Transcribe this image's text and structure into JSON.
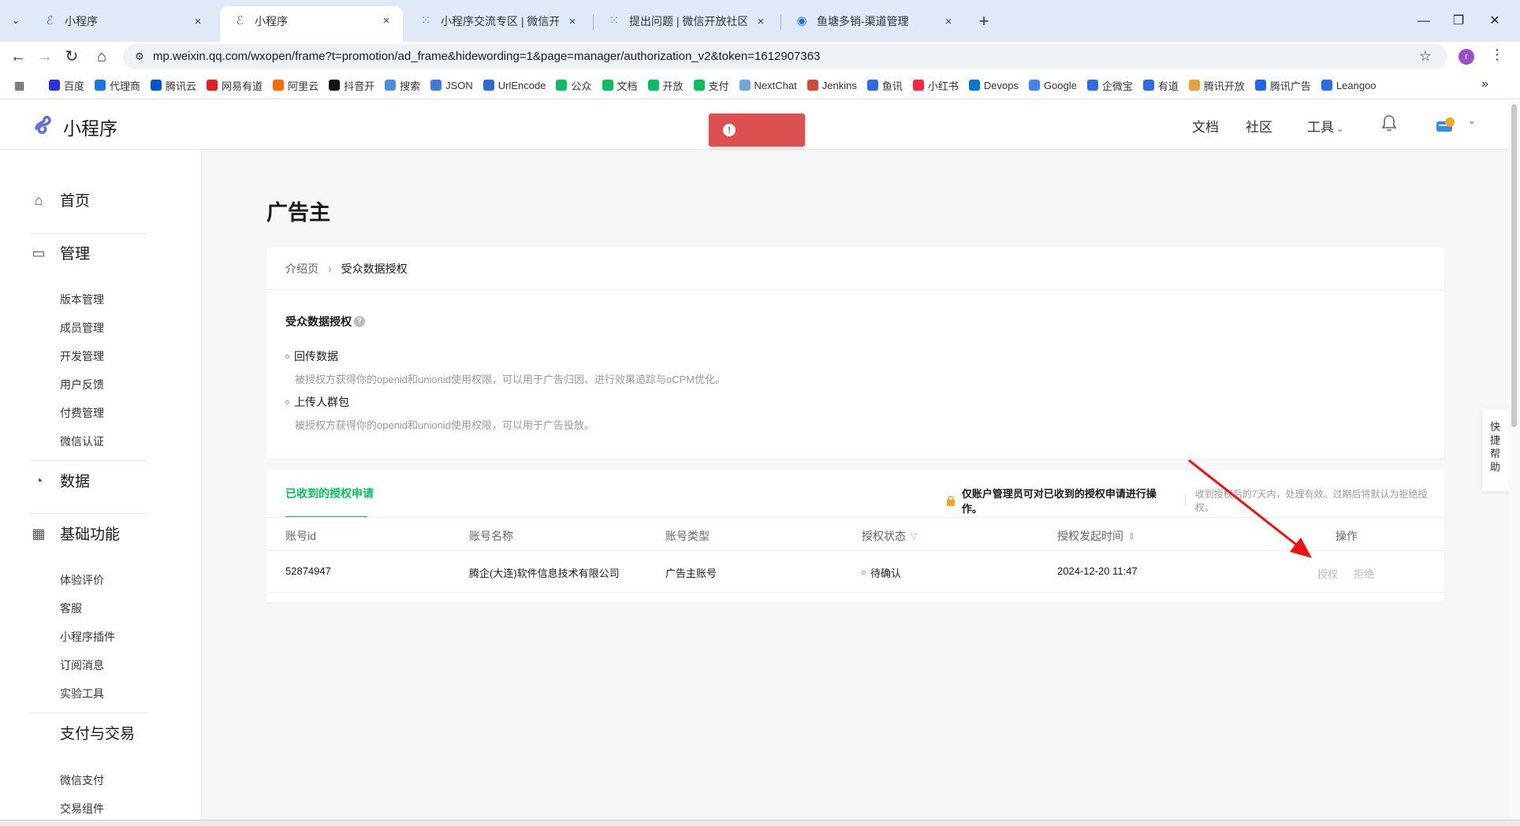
{
  "browser": {
    "tabs": [
      {
        "title": "小程序",
        "icon": "miniprogram-icon",
        "active": false
      },
      {
        "title": "小程序",
        "icon": "miniprogram-icon",
        "active": true
      },
      {
        "title": "小程序交流专区 | 微信开放社区",
        "icon": "community-grid-icon",
        "active": false
      },
      {
        "title": "提出问题 | 微信开放社区",
        "icon": "community-grid-icon",
        "active": false
      },
      {
        "title": "鱼塘多销-渠道管理",
        "icon": "globe-icon",
        "active": false
      }
    ],
    "url": "mp.weixin.qq.com/wxopen/frame?t=promotion/ad_frame&hidewording=1&page=manager/authorization_v2&token=1612907363",
    "profile_initial": "r",
    "bookmarks": [
      {
        "label": "百度",
        "color": "#2932e1"
      },
      {
        "label": "代理商",
        "color": "#1a73e8"
      },
      {
        "label": "腾讯云",
        "color": "#0052d9"
      },
      {
        "label": "网易有道",
        "color": "#e02020"
      },
      {
        "label": "阿里云",
        "color": "#ff6a00"
      },
      {
        "label": "抖音开",
        "color": "#111111"
      },
      {
        "label": "搜索",
        "color": "#4a90e2"
      },
      {
        "label": "JSON",
        "color": "#3b7ddd"
      },
      {
        "label": "UrlEncode",
        "color": "#2a6bd1"
      },
      {
        "label": "公众",
        "color": "#07c160"
      },
      {
        "label": "文档",
        "color": "#07c160"
      },
      {
        "label": "开放",
        "color": "#07c160"
      },
      {
        "label": "支付",
        "color": "#07c160"
      },
      {
        "label": "NextChat",
        "color": "#6fa8dc"
      },
      {
        "label": "Jenkins",
        "color": "#d24939"
      },
      {
        "label": "鱼讯",
        "color": "#2b6de8"
      },
      {
        "label": "小红书",
        "color": "#ff2442"
      },
      {
        "label": "Devops",
        "color": "#0078d4"
      },
      {
        "label": "Google",
        "color": "#4285f4"
      },
      {
        "label": "企微宝",
        "color": "#2b6de8"
      },
      {
        "label": "有道",
        "color": "#2b6de8"
      },
      {
        "label": "腾讯开放",
        "color": "#e9a23b"
      },
      {
        "label": "腾讯广告",
        "color": "#1c64f2"
      },
      {
        "label": "Leangoo",
        "color": "#2b6de8"
      }
    ]
  },
  "topnav": {
    "brand": "小程序",
    "links": [
      "文档",
      "社区",
      "工具"
    ],
    "toast_text": ""
  },
  "sidebar": {
    "groups": [
      {
        "label": "首页",
        "icon": "home-icon",
        "items": []
      },
      {
        "label": "管理",
        "icon": "inbox-icon",
        "items": [
          "版本管理",
          "成员管理",
          "开发管理",
          "用户反馈",
          "付费管理",
          "微信认证"
        ]
      },
      {
        "label": "数据",
        "icon": "pie-chart-icon",
        "items": []
      },
      {
        "label": "基础功能",
        "icon": "grid-icon",
        "items": [
          "体验评价",
          "客服",
          "小程序插件",
          "订阅消息",
          "实验工具"
        ]
      },
      {
        "label": "支付与交易",
        "icon": "",
        "items": [
          "微信支付",
          "交易组件"
        ]
      }
    ]
  },
  "main": {
    "title": "广告主",
    "breadcrumb": {
      "parent": "介绍页",
      "current": "受众数据授权"
    },
    "section_title": "受众数据授权",
    "permissions": [
      {
        "name": "回传数据",
        "desc": "被授权方获得你的openid和unionid使用权限，可以用于广告归因、进行效果追踪与oCPM优化。"
      },
      {
        "name": "上传人群包",
        "desc": "被授权方获得你的openid和unionid使用权限，可以用于广告投放。"
      }
    ],
    "requests": {
      "tab_label": "已收到的授权申请",
      "notice_main": "仅账户管理员可对已收到的授权申请进行操作。",
      "notice_sub": "收到授权后的7天内，处理有效。过期后将默认为拒绝授权。",
      "columns": [
        "账号id",
        "账号名称",
        "账号类型",
        "授权状态",
        "授权发起时间",
        "操作"
      ],
      "rows": [
        {
          "id": "52874947",
          "name": "腾企(大连)软件信息技术有限公司",
          "type": "广告主账号",
          "status": "待确认",
          "time": "2024-12-20 11:47",
          "actions": [
            "授权",
            "拒绝"
          ]
        }
      ]
    }
  },
  "help_float": "快捷帮助",
  "colors": {
    "accent": "#07c160",
    "toast": "#dc5050",
    "annotation_arrow": "#ee1111"
  }
}
